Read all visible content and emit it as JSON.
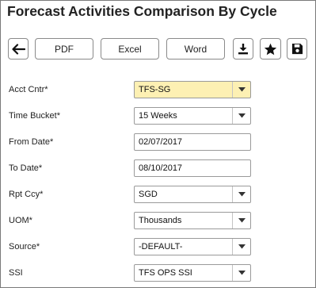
{
  "page": {
    "title": "Forecast Activities Comparison By Cycle"
  },
  "toolbar": {
    "back_icon": "arrow-left-icon",
    "pdf_label": "PDF",
    "excel_label": "Excel",
    "word_label": "Word",
    "download_icon": "download-icon",
    "favorite_icon": "star-icon",
    "save_icon": "floppy-disk-icon"
  },
  "form": {
    "acct_cntr": {
      "label": "Acct Cntr*",
      "value": "TFS-SG"
    },
    "time_bucket": {
      "label": "Time Bucket*",
      "value": "15 Weeks"
    },
    "from_date": {
      "label": "From Date*",
      "value": "02/07/2017"
    },
    "to_date": {
      "label": "To Date*",
      "value": "08/10/2017"
    },
    "rpt_ccy": {
      "label": "Rpt Ccy*",
      "value": "SGD"
    },
    "uom": {
      "label": "UOM*",
      "value": "Thousands"
    },
    "source": {
      "label": "Source*",
      "value": "-DEFAULT-"
    },
    "ssi": {
      "label": "SSI",
      "value": "TFS OPS SSI"
    }
  },
  "colors": {
    "highlight_field": "#fdf0b3",
    "border": "#8a8a8a",
    "text": "#222222"
  }
}
